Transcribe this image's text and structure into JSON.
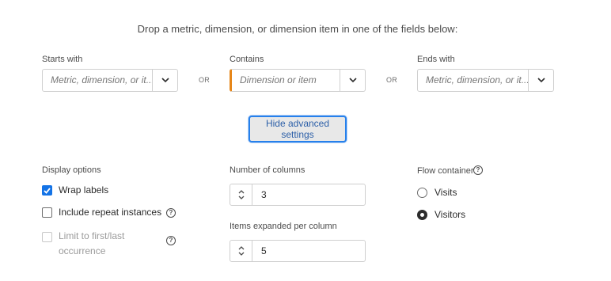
{
  "instruction": "Drop a metric, dimension, or dimension item in one of the fields below:",
  "fields": {
    "starts_with": {
      "label": "Starts with",
      "placeholder": "Metric, dimension, or it..."
    },
    "contains": {
      "label": "Contains",
      "placeholder": "Dimension or item"
    },
    "ends_with": {
      "label": "Ends with",
      "placeholder": "Metric, dimension, or it..."
    },
    "or_label": "OR"
  },
  "advanced_button": "Hide advanced settings",
  "display_options": {
    "label": "Display options",
    "wrap_labels": {
      "label": "Wrap labels",
      "checked": true
    },
    "include_repeat": {
      "label": "Include repeat instances",
      "checked": false
    },
    "limit_first_last": {
      "label_line1": "Limit to first/last",
      "label_line2": "occurrence",
      "checked": false,
      "disabled": true
    }
  },
  "number_of_columns": {
    "label": "Number of columns",
    "value": "3"
  },
  "items_expanded": {
    "label": "Items expanded per column",
    "value": "5"
  },
  "flow_container": {
    "label": "Flow container",
    "options": [
      {
        "label": "Visits",
        "selected": false
      },
      {
        "label": "Visitors",
        "selected": true
      }
    ]
  },
  "colors": {
    "accent_orange": "#e68619",
    "focus_blue": "#2680eb",
    "checkbox_blue": "#1473e6"
  }
}
